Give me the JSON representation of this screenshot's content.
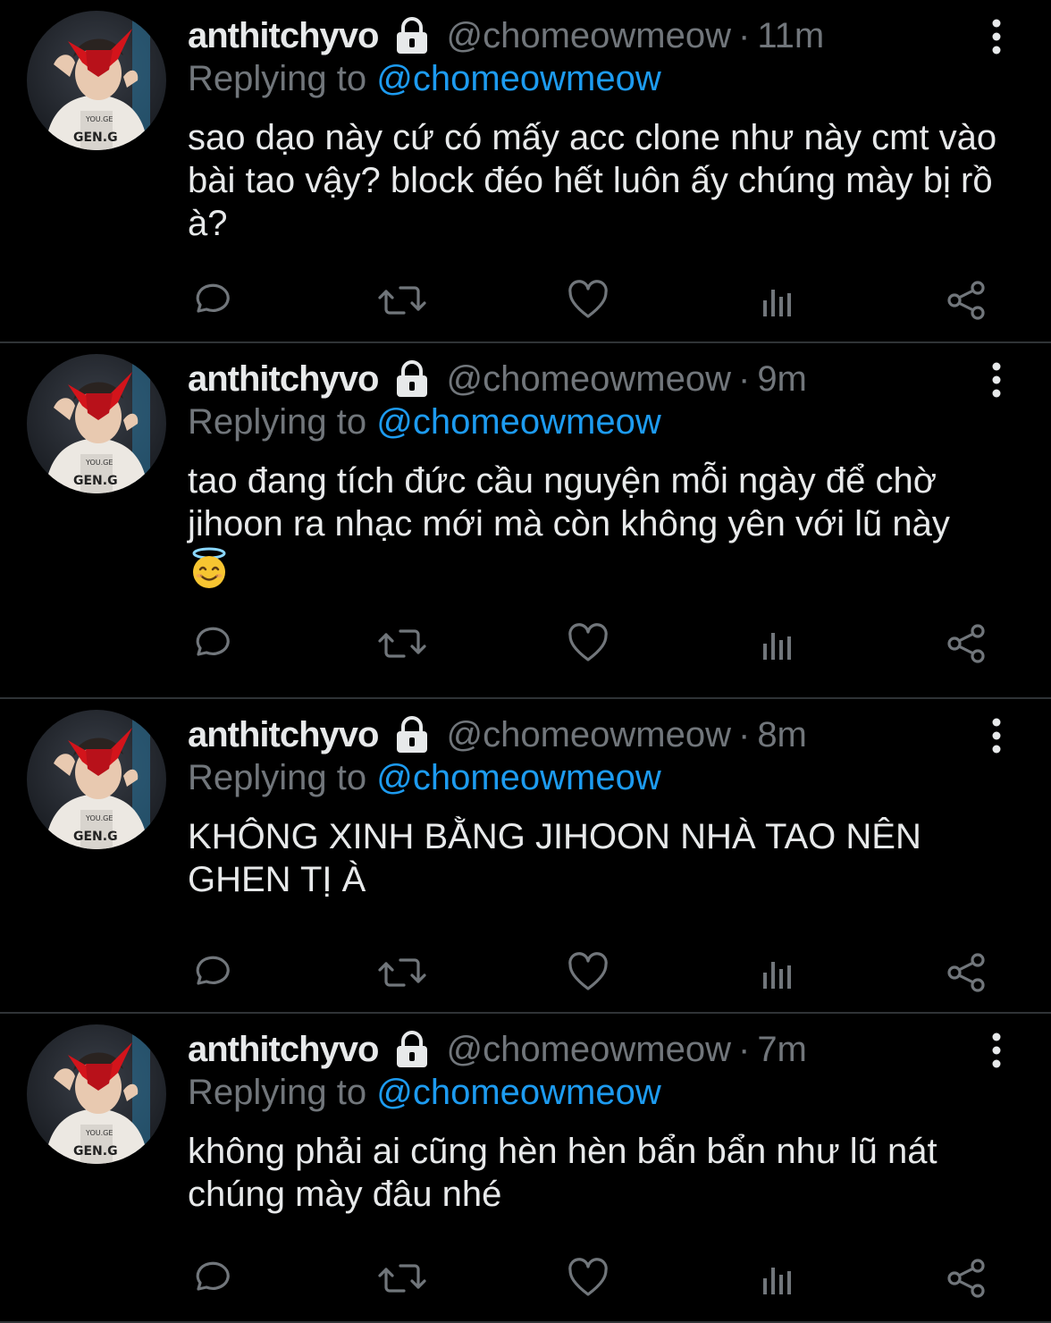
{
  "colors": {
    "background": "#000000",
    "text": "#e7e9ea",
    "muted": "#71767b",
    "link": "#1d9bf0",
    "divider": "#2f3336"
  },
  "tweets": [
    {
      "display_name": "anthitchyvo",
      "handle": "@chomeowmeow",
      "separator": "·",
      "time": "11m",
      "replying_prefix": "Replying to",
      "replying_to": "@chomeowmeow",
      "text": "sao dạo này cứ có mấy acc clone như này cmt vào bài tao vậy? block đéo hết luôn ấy chúng mày bị rồ à?",
      "has_emoji": false,
      "icons": [
        "lock-icon",
        "more-icon",
        "reply-icon",
        "retweet-icon",
        "like-icon",
        "analytics-icon",
        "share-icon"
      ]
    },
    {
      "display_name": "anthitchyvo",
      "handle": "@chomeowmeow",
      "separator": "·",
      "time": "9m",
      "replying_prefix": "Replying to",
      "replying_to": "@chomeowmeow",
      "text": "tao đang tích đức cầu nguyện mỗi ngày để chờ jihoon ra nhạc mới mà còn không yên với lũ này",
      "has_emoji": true,
      "emoji": "😇",
      "icons": [
        "lock-icon",
        "more-icon",
        "reply-icon",
        "retweet-icon",
        "like-icon",
        "analytics-icon",
        "share-icon"
      ]
    },
    {
      "display_name": "anthitchyvo",
      "handle": "@chomeowmeow",
      "separator": "·",
      "time": "8m",
      "replying_prefix": "Replying to",
      "replying_to": "@chomeowmeow",
      "text": "KHÔNG XINH BẰNG JIHOON NHÀ TAO NÊN GHEN TỊ À",
      "has_emoji": false,
      "icons": [
        "lock-icon",
        "more-icon",
        "reply-icon",
        "retweet-icon",
        "like-icon",
        "analytics-icon",
        "share-icon"
      ]
    },
    {
      "display_name": "anthitchyvo",
      "handle": "@chomeowmeow",
      "separator": "·",
      "time": "7m",
      "replying_prefix": "Replying to",
      "replying_to": "@chomeowmeow",
      "text": "không phải ai cũng hèn hèn bẩn bẩn như lũ nát chúng mày đâu nhé",
      "has_emoji": false,
      "icons": [
        "lock-icon",
        "more-icon",
        "reply-icon",
        "retweet-icon",
        "like-icon",
        "analytics-icon",
        "share-icon"
      ]
    }
  ]
}
